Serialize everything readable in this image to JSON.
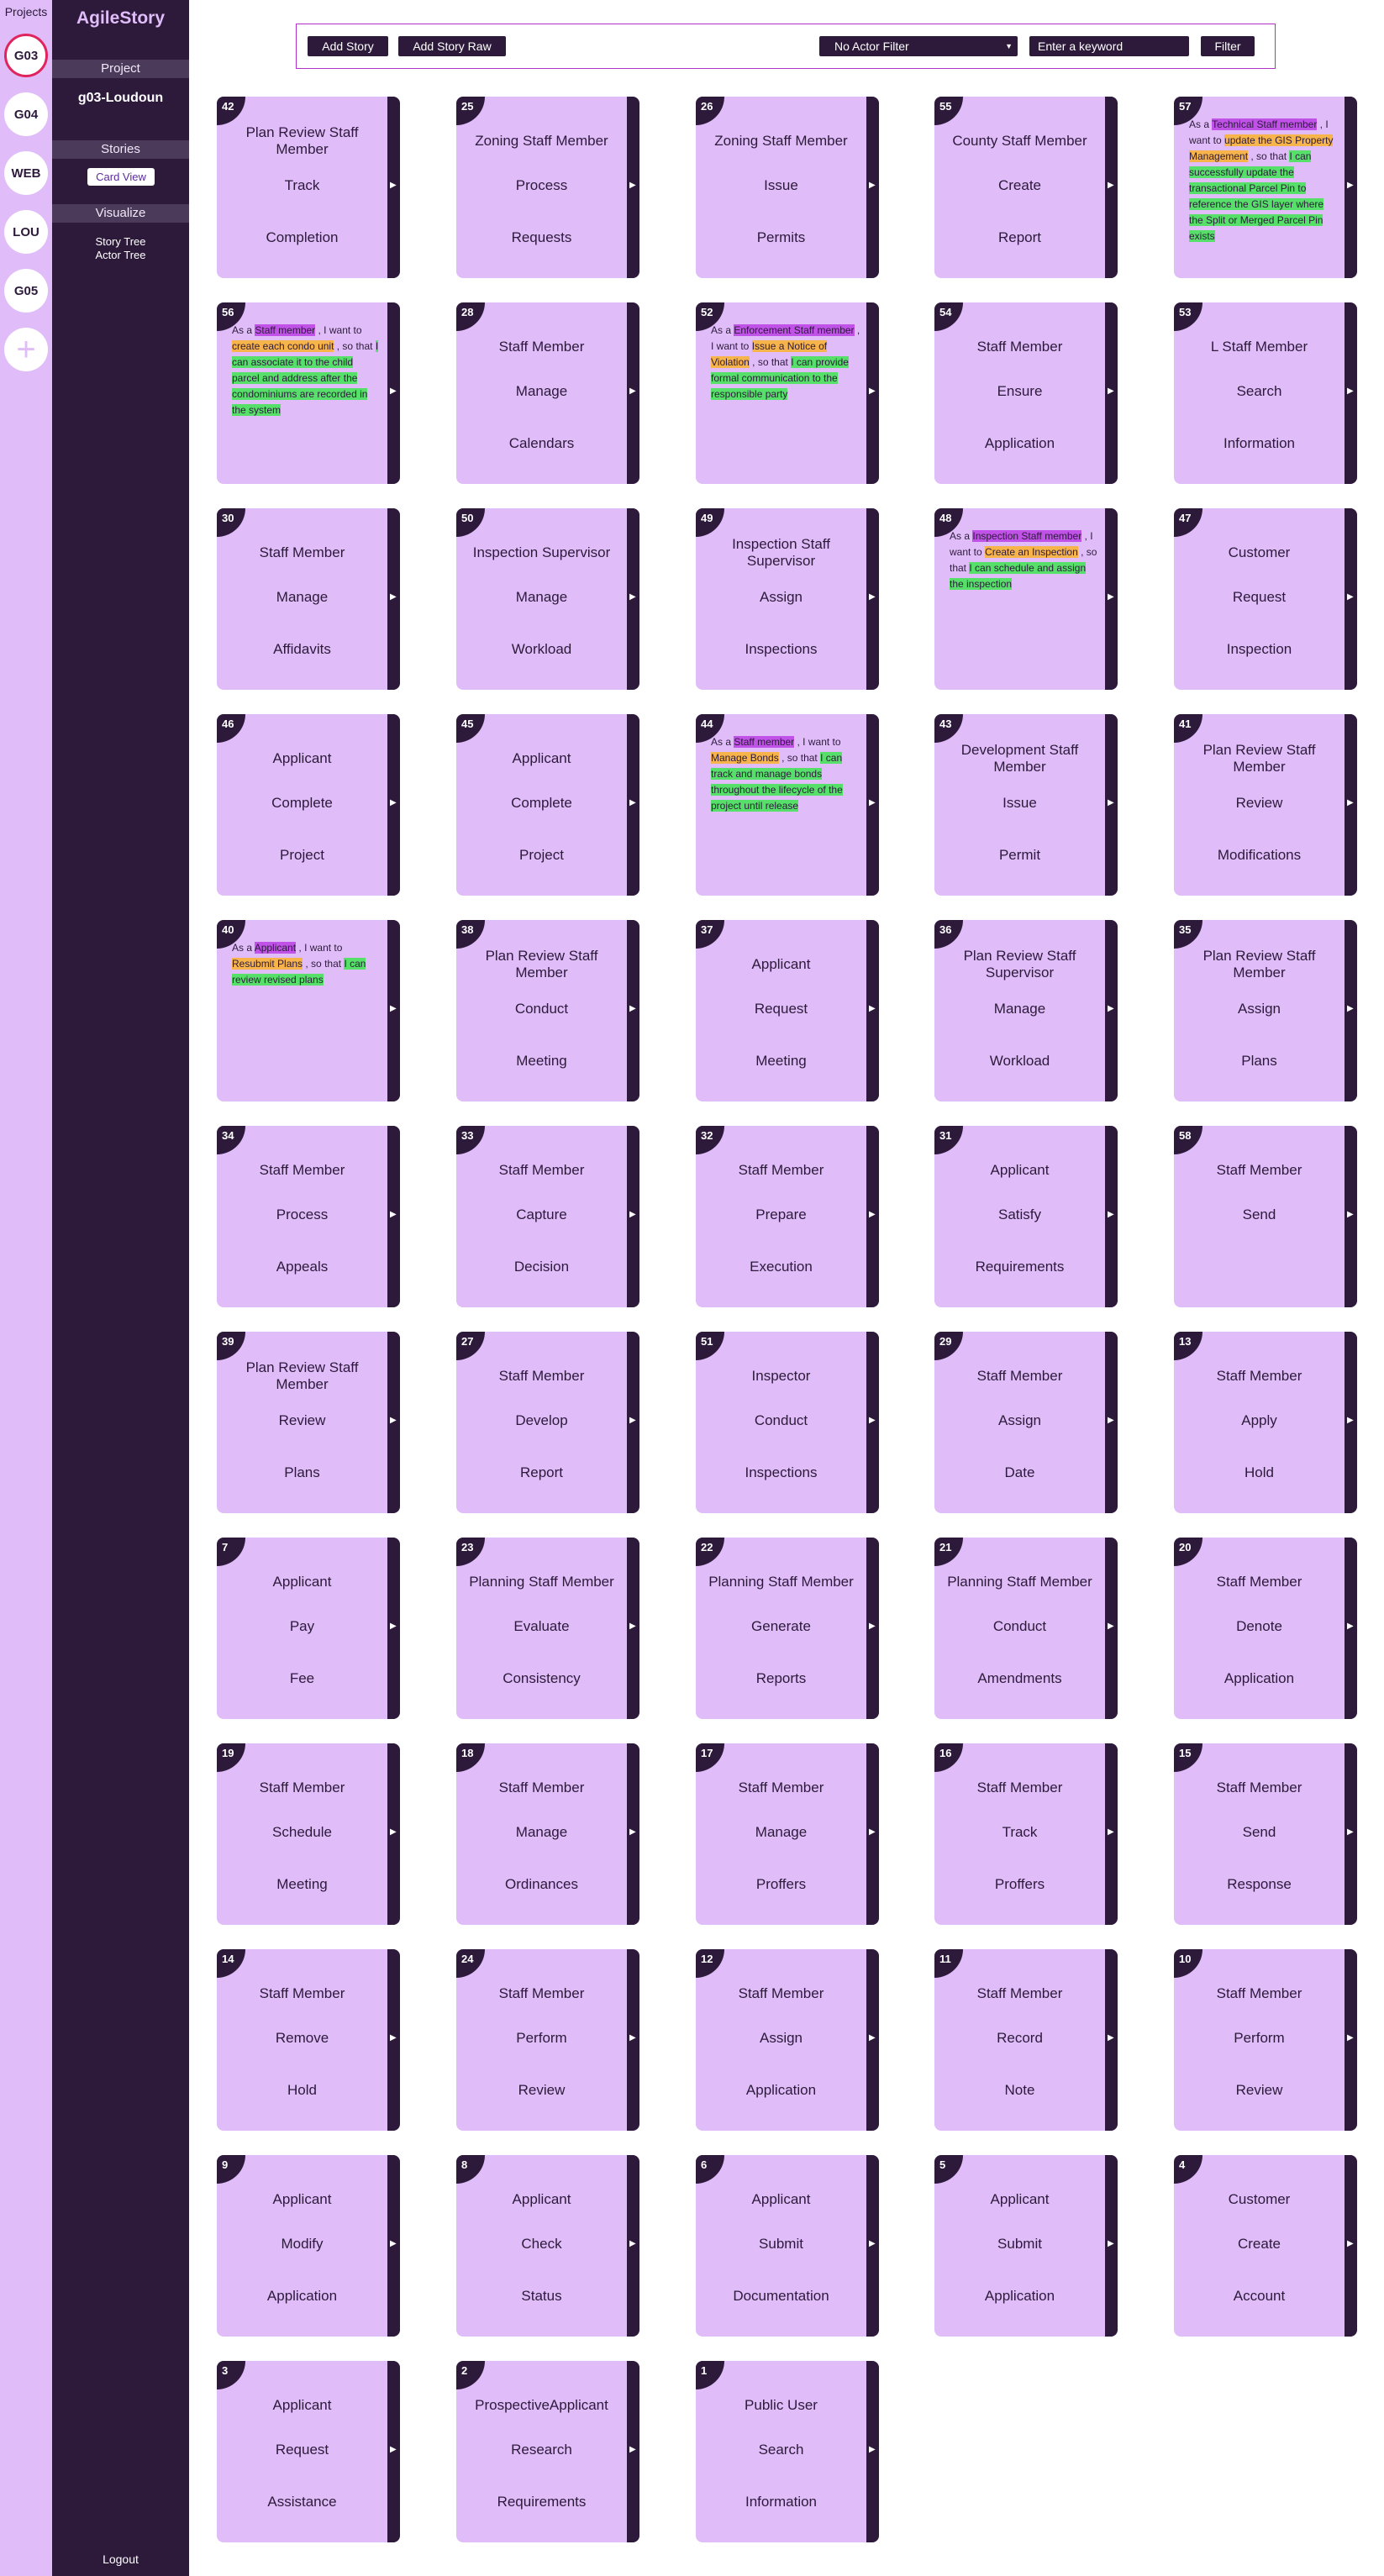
{
  "sidebar_projects": {
    "title": "Projects",
    "items": [
      "G03",
      "G04",
      "WEB",
      "LOU",
      "G05"
    ],
    "add_label": "+"
  },
  "sidebar": {
    "app_name": "AgileStory",
    "project_header": "Project",
    "project_name": "g03-Loudoun",
    "stories_header": "Stories",
    "card_view": "Card View",
    "visualize_header": "Visualize",
    "story_tree": "Story Tree",
    "actor_tree": "Actor Tree",
    "logout": "Logout"
  },
  "toolbar": {
    "add_story": "Add Story",
    "add_story_raw": "Add Story Raw",
    "actor_filter": "No Actor Filter",
    "keyword_placeholder": "Enter a keyword",
    "filter": "Filter"
  },
  "cards": [
    {
      "id": "42",
      "actor": "Plan Review Staff Member",
      "action": "Track",
      "object": "Completion"
    },
    {
      "id": "25",
      "actor": "Zoning Staff Member",
      "action": "Process",
      "object": "Requests"
    },
    {
      "id": "26",
      "actor": "Zoning Staff Member",
      "action": "Issue",
      "object": "Permits"
    },
    {
      "id": "55",
      "actor": "County Staff Member",
      "action": "Create",
      "object": "Report"
    },
    {
      "id": "57",
      "expanded": true,
      "p1": "As a",
      "a": "Technical Staff member",
      "p2": ", I want to",
      "g": "update the GIS Property Management",
      "p3": ", so that",
      "b": "I can successfully update the transactional Parcel Pin to reference the GIS layer where the Split or Merged Parcel Pin exists"
    },
    {
      "id": "56",
      "expanded": true,
      "p1": "As a",
      "a": "Staff member",
      "p2": ", I want to",
      "g": "create each condo unit",
      "p3": ", so that",
      "b": "I can associate it to the child parcel and address after the condominiums are recorded in the system"
    },
    {
      "id": "28",
      "actor": "Staff Member",
      "action": "Manage",
      "object": "Calendars"
    },
    {
      "id": "52",
      "expanded": true,
      "p1": "As a",
      "a": "Enforcement Staff member",
      "p2": ", I want to",
      "g": "Issue a Notice of Violation",
      "p3": ", so that",
      "b": "I can provide formal communication to the responsible party"
    },
    {
      "id": "54",
      "actor": "Staff Member",
      "action": "Ensure",
      "object": "Application"
    },
    {
      "id": "53",
      "actor": "L Staff Member",
      "action": "Search",
      "object": "Information"
    },
    {
      "id": "30",
      "actor": "Staff Member",
      "action": "Manage",
      "object": "Affidavits"
    },
    {
      "id": "50",
      "actor": "Inspection Supervisor",
      "action": "Manage",
      "object": "Workload"
    },
    {
      "id": "49",
      "actor": "Inspection Staff Supervisor",
      "action": "Assign",
      "object": "Inspections"
    },
    {
      "id": "48",
      "expanded": true,
      "p1": "As a",
      "a": "Inspection Staff member",
      "p2": ", I want to",
      "g": "Create an Inspection",
      "p3": ", so that",
      "b": "I can schedule and assign the inspection"
    },
    {
      "id": "47",
      "actor": "Customer",
      "action": "Request",
      "object": "Inspection"
    },
    {
      "id": "46",
      "actor": "Applicant",
      "action": "Complete",
      "object": "Project"
    },
    {
      "id": "45",
      "actor": "Applicant",
      "action": "Complete",
      "object": "Project"
    },
    {
      "id": "44",
      "expanded": true,
      "p1": "As a",
      "a": "Staff member",
      "p2": ", I want to",
      "g": "Manage Bonds",
      "p3": ", so that",
      "b": "I can track and manage bonds throughout the lifecycle of the project until release"
    },
    {
      "id": "43",
      "actor": "Development Staff Member",
      "action": "Issue",
      "object": "Permit"
    },
    {
      "id": "41",
      "actor": "Plan Review Staff Member",
      "action": "Review",
      "object": "Modifications"
    },
    {
      "id": "40",
      "expanded": true,
      "p1": "As a",
      "a": "Applicant",
      "p2": ", I want to",
      "g": "Resubmit Plans",
      "p3": ", so that",
      "b": "I can review revised plans"
    },
    {
      "id": "38",
      "actor": "Plan Review Staff Member",
      "action": "Conduct",
      "object": "Meeting"
    },
    {
      "id": "37",
      "actor": "Applicant",
      "action": "Request",
      "object": "Meeting"
    },
    {
      "id": "36",
      "actor": "Plan Review Staff Supervisor",
      "action": "Manage",
      "object": "Workload"
    },
    {
      "id": "35",
      "actor": "Plan Review Staff Member",
      "action": "Assign",
      "object": "Plans"
    },
    {
      "id": "34",
      "actor": "Staff Member",
      "action": "Process",
      "object": "Appeals"
    },
    {
      "id": "33",
      "actor": "Staff Member",
      "action": "Capture",
      "object": "Decision"
    },
    {
      "id": "32",
      "actor": "Staff Member",
      "action": "Prepare",
      "object": "Execution"
    },
    {
      "id": "31",
      "actor": "Applicant",
      "action": "Satisfy",
      "object": "Requirements"
    },
    {
      "id": "58",
      "actor": "Staff Member",
      "action": "Send",
      "object": ""
    },
    {
      "id": "39",
      "actor": "Plan Review Staff Member",
      "action": "Review",
      "object": "Plans"
    },
    {
      "id": "27",
      "actor": "Staff Member",
      "action": "Develop",
      "object": "Report"
    },
    {
      "id": "51",
      "actor": "Inspector",
      "action": "Conduct",
      "object": "Inspections"
    },
    {
      "id": "29",
      "actor": "Staff Member",
      "action": "Assign",
      "object": "Date"
    },
    {
      "id": "13",
      "actor": "Staff Member",
      "action": "Apply",
      "object": "Hold"
    },
    {
      "id": "7",
      "actor": "Applicant",
      "action": "Pay",
      "object": "Fee"
    },
    {
      "id": "23",
      "actor": "Planning Staff Member",
      "action": "Evaluate",
      "object": "Consistency"
    },
    {
      "id": "22",
      "actor": "Planning Staff Member",
      "action": "Generate",
      "object": "Reports"
    },
    {
      "id": "21",
      "actor": "Planning Staff Member",
      "action": "Conduct",
      "object": "Amendments"
    },
    {
      "id": "20",
      "actor": "Staff Member",
      "action": "Denote",
      "object": "Application"
    },
    {
      "id": "19",
      "actor": "Staff Member",
      "action": "Schedule",
      "object": "Meeting"
    },
    {
      "id": "18",
      "actor": "Staff Member",
      "action": "Manage",
      "object": "Ordinances"
    },
    {
      "id": "17",
      "actor": "Staff Member",
      "action": "Manage",
      "object": "Proffers"
    },
    {
      "id": "16",
      "actor": "Staff Member",
      "action": "Track",
      "object": "Proffers"
    },
    {
      "id": "15",
      "actor": "Staff Member",
      "action": "Send",
      "object": "Response"
    },
    {
      "id": "14",
      "actor": "Staff Member",
      "action": "Remove",
      "object": "Hold"
    },
    {
      "id": "24",
      "actor": "Staff Member",
      "action": "Perform",
      "object": "Review"
    },
    {
      "id": "12",
      "actor": "Staff Member",
      "action": "Assign",
      "object": "Application"
    },
    {
      "id": "11",
      "actor": "Staff Member",
      "action": "Record",
      "object": "Note"
    },
    {
      "id": "10",
      "actor": "Staff Member",
      "action": "Perform",
      "object": "Review"
    },
    {
      "id": "9",
      "actor": "Applicant",
      "action": "Modify",
      "object": "Application"
    },
    {
      "id": "8",
      "actor": "Applicant",
      "action": "Check",
      "object": "Status"
    },
    {
      "id": "6",
      "actor": "Applicant",
      "action": "Submit",
      "object": "Documentation"
    },
    {
      "id": "5",
      "actor": "Applicant",
      "action": "Submit",
      "object": "Application"
    },
    {
      "id": "4",
      "actor": "Customer",
      "action": "Create",
      "object": "Account"
    },
    {
      "id": "3",
      "actor": "Applicant",
      "action": "Request",
      "object": "Assistance"
    },
    {
      "id": "2",
      "actor": "ProspectiveApplicant",
      "action": "Research",
      "object": "Requirements"
    },
    {
      "id": "1",
      "actor": "Public User",
      "action": "Search",
      "object": "Information"
    }
  ]
}
